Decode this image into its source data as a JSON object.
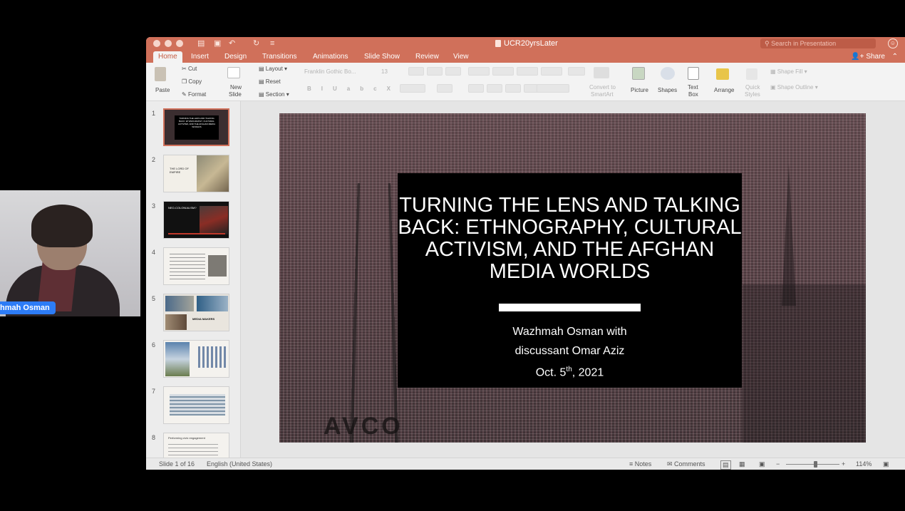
{
  "participant": {
    "name_fragment": "hmah Osman"
  },
  "window": {
    "title": "UCR20yrsLater",
    "search_placeholder": "Search in Presentation",
    "share_label": "Share"
  },
  "tabs": [
    "Home",
    "Insert",
    "Design",
    "Transitions",
    "Animations",
    "Slide Show",
    "Review",
    "View"
  ],
  "active_tab": "Home",
  "ribbon": {
    "paste": "Paste",
    "cut": "Cut",
    "copy": "Copy",
    "format": "Format",
    "new_slide_1": "New",
    "new_slide_2": "Slide",
    "layout": "Layout",
    "reset": "Reset",
    "section": "Section",
    "font_name": "Franklin Gothic Bo...",
    "font_size": "13",
    "convert_1": "Convert to",
    "convert_2": "SmartArt",
    "picture": "Picture",
    "shapes": "Shapes",
    "textbox_1": "Text",
    "textbox_2": "Box",
    "arrange": "Arrange",
    "quick_1": "Quick",
    "quick_2": "Styles",
    "shape_fill": "Shape Fill",
    "shape_outline": "Shape Outline"
  },
  "thumbnails": [
    {
      "num": "1",
      "text": "TURNING THE LENS AND TALKING BACK: ETHNOGRAPHY, CULTURAL ACTIVISM, AND THE AFGHAN MEDIA WORLDS"
    },
    {
      "num": "2",
      "text": "THE LORD OF EMPIRE"
    },
    {
      "num": "3",
      "text": "NEO-COLONIALISM?"
    },
    {
      "num": "4",
      "text": ""
    },
    {
      "num": "5",
      "text": "MEDIA MAKERS"
    },
    {
      "num": "6",
      "text": ""
    },
    {
      "num": "7",
      "text": ""
    },
    {
      "num": "8",
      "text": "Performing civic engagement"
    }
  ],
  "slide": {
    "title": "TURNING THE LENS AND TALKING BACK: ETHNOGRAPHY, CULTURAL ACTIVISM, AND THE AFGHAN MEDIA WORLDS",
    "line1": "Wazhmah Osman with",
    "line2": "discussant Omar Aziz",
    "date_prefix": "Oct. 5",
    "date_sup": "th",
    "date_suffix": ", 2021",
    "watermark": "AVCO"
  },
  "status": {
    "slide_counter": "Slide 1 of 16",
    "language": "English (United States)",
    "notes": "Notes",
    "comments": "Comments",
    "zoom": "114%",
    "zoom_fraction": 0.55
  }
}
